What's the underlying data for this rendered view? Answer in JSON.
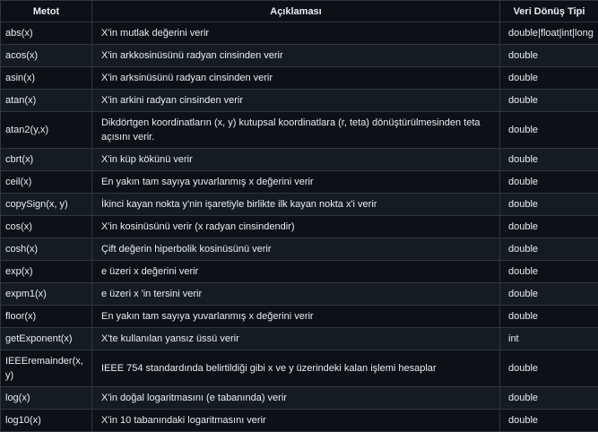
{
  "table": {
    "headers": {
      "method": "Metot",
      "description": "Açıklaması",
      "return_type": "Veri Dönüş Tipi"
    },
    "rows": [
      {
        "method": "abs(x)",
        "description": "X'in mutlak değerini verir",
        "return_type": "double|float|int|long"
      },
      {
        "method": "acos(x)",
        "description": "X'in arkkosinüsünü radyan cinsinden verir",
        "return_type": "double"
      },
      {
        "method": "asin(x)",
        "description": "X'in arksinüsünü radyan cinsinden verir",
        "return_type": "double"
      },
      {
        "method": "atan(x)",
        "description": "X'in arkini radyan cinsinden verir",
        "return_type": "double"
      },
      {
        "method": "atan2(y,x)",
        "description": "Dikdörtgen koordinatların (x, y) kutupsal koordinatlara (r, teta) dönüştürülmesinden teta açısını verir.",
        "return_type": "double"
      },
      {
        "method": "cbrt(x)",
        "description": "X'in küp kökünü verir",
        "return_type": "double"
      },
      {
        "method": "ceil(x)",
        "description": "En yakın tam sayıya yuvarlanmış x değerini verir",
        "return_type": "double"
      },
      {
        "method": "copySign(x, y)",
        "description": "İkinci kayan nokta y'nin işaretiyle birlikte ilk kayan nokta x'i verir",
        "return_type": "double"
      },
      {
        "method": "cos(x)",
        "description": "X'in kosinüsünü verir (x radyan cinsindendir)",
        "return_type": "double"
      },
      {
        "method": "cosh(x)",
        "description": "Çift değerin hiperbolik kosinüsünü verir",
        "return_type": "double"
      },
      {
        "method": "exp(x)",
        "description": "e üzeri x değerini verir",
        "return_type": "double"
      },
      {
        "method": "expm1(x)",
        "description": "e üzeri x 'in tersini verir",
        "return_type": "double"
      },
      {
        "method": "floor(x)",
        "description": "En yakın tam sayıya yuvarlanmış x değerini verir",
        "return_type": "double"
      },
      {
        "method": "getExponent(x)",
        "description": "X'te kullanılan yansız üssü verir",
        "return_type": "int"
      },
      {
        "method": "IEEEremainder(x, y)",
        "description": "IEEE 754 standardında belirtildiği gibi x ve y üzerindeki kalan işlemi hesaplar",
        "return_type": "double"
      },
      {
        "method": "log(x)",
        "description": "X'in doğal logaritmasını (e tabanında) verir",
        "return_type": "double"
      },
      {
        "method": "log10(x)",
        "description": "X'in 10 tabanındaki logaritmasını verir",
        "return_type": "double"
      }
    ]
  }
}
